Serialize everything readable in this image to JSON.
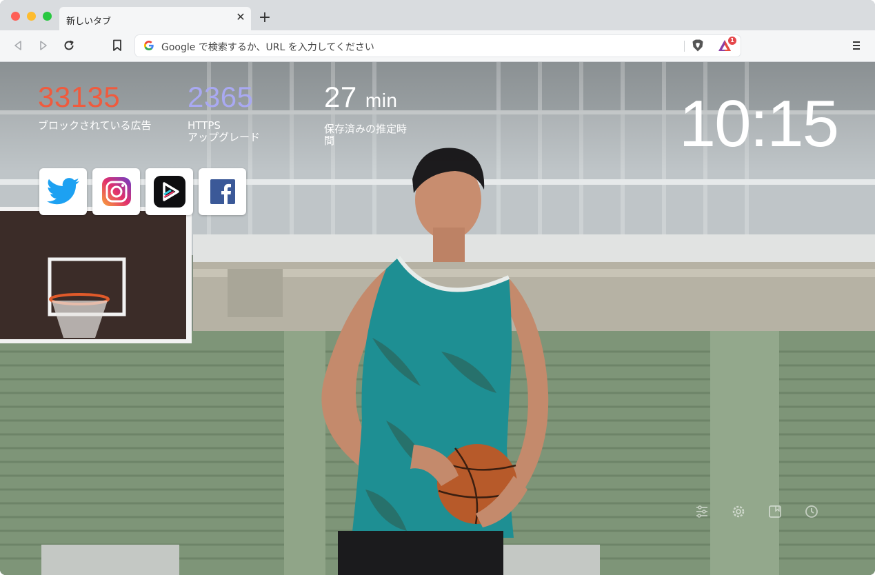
{
  "browser": {
    "tab_title": "新しいタブ",
    "close_glyph": "✕",
    "new_tab_glyph": "+",
    "url_placeholder": "Google で検索するか、URL を入力してください",
    "rewards_badge": "1"
  },
  "stats": {
    "ads_blocked": {
      "value": "33135",
      "label": "ブロックされている広告",
      "color": "#ef5b3e"
    },
    "https_upgrades": {
      "value": "2365",
      "label_line1": "HTTPS",
      "label_line2": "アップグレード",
      "color": "#a9a9f2"
    },
    "time_saved": {
      "value": "27",
      "unit": "min",
      "label_line1": "保存済みの推定時",
      "label_line2": "間"
    }
  },
  "clock": "10:15",
  "top_sites": [
    {
      "name": "twitter",
      "icon": "twitter-icon"
    },
    {
      "name": "instagram",
      "icon": "instagram-icon"
    },
    {
      "name": "app",
      "icon": "play-app-icon"
    },
    {
      "name": "facebook",
      "icon": "facebook-icon"
    }
  ],
  "controls": [
    "customize-icon",
    "settings-icon",
    "bookmarks-icon",
    "history-icon"
  ]
}
